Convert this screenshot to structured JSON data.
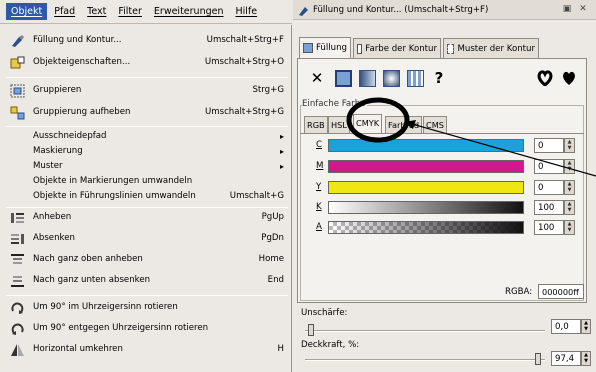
{
  "menubar": [
    "Objekt",
    "Pfad",
    "Text",
    "Filter",
    "Erweiterungen",
    "Hilfe"
  ],
  "menu": {
    "items": [
      {
        "label": "Füllung und Kontur...",
        "shortcut": "Umschalt+Strg+F",
        "icon": "fill-stroke-icon"
      },
      {
        "label": "Objekteigenschaften...",
        "shortcut": "Umschalt+Strg+O",
        "icon": "object-properties-icon"
      },
      {
        "label": "Gruppieren",
        "shortcut": "Strg+G",
        "icon": "group-icon"
      },
      {
        "label": "Gruppierung aufheben",
        "shortcut": "Umschalt+Strg+G",
        "icon": "ungroup-icon"
      },
      {
        "label": "Ausschneidepfad",
        "shortcut": "▸",
        "icon": ""
      },
      {
        "label": "Maskierung",
        "shortcut": "▸",
        "icon": ""
      },
      {
        "label": "Muster",
        "shortcut": "▸",
        "icon": ""
      },
      {
        "label": "Objekte in Markierungen umwandeln",
        "shortcut": "",
        "icon": ""
      },
      {
        "label": "Objekte in Führungslinien umwandeln",
        "shortcut": "Umschalt+G",
        "icon": ""
      },
      {
        "label": "Anheben",
        "shortcut": "PgUp",
        "icon": "raise-icon"
      },
      {
        "label": "Absenken",
        "shortcut": "PgDn",
        "icon": "lower-icon"
      },
      {
        "label": "Nach ganz oben anheben",
        "shortcut": "Home",
        "icon": "raise-to-top-icon"
      },
      {
        "label": "Nach ganz unten absenken",
        "shortcut": "End",
        "icon": "lower-to-bottom-icon"
      },
      {
        "label": "Um 90° im Uhrzeigersinn rotieren",
        "shortcut": "",
        "icon": "rotate-cw-icon"
      },
      {
        "label": "Um 90° entgegen Uhrzeigersinn rotieren",
        "shortcut": "",
        "icon": "rotate-ccw-icon"
      },
      {
        "label": "Horizontal umkehren",
        "shortcut": "H",
        "icon": "flip-horizontal-icon"
      }
    ]
  },
  "dialog": {
    "title": "Füllung und Kontur... (Umschalt+Strg+F)",
    "tabs": [
      "Füllung",
      "Farbe der Kontur",
      "Muster der Kontur"
    ],
    "flat_legend": "Einfache Farbe",
    "mode_tabs": [
      "RGB",
      "HSL",
      "CMYK",
      "Farbrad",
      "CMS"
    ],
    "channels": [
      {
        "key": "C",
        "value": "0",
        "color": "#1ea0dc"
      },
      {
        "key": "M",
        "value": "0",
        "color": "#d2188c"
      },
      {
        "key": "Y",
        "value": "0",
        "color": "#f0e614"
      },
      {
        "key": "K",
        "value": "100",
        "color": "#111111"
      },
      {
        "key": "A",
        "value": "100",
        "color": "#111111"
      }
    ],
    "rgba_label": "RGBA:",
    "rgba_value": "000000ff",
    "blur_label": "Unschärfe:",
    "blur_value": "0,0",
    "opacity_label": "Deckkraft, %:",
    "opacity_value": "97,4",
    "question_mark": "?"
  },
  "colors": {
    "accent": "#2a5aa8",
    "highlight": "#000000"
  }
}
